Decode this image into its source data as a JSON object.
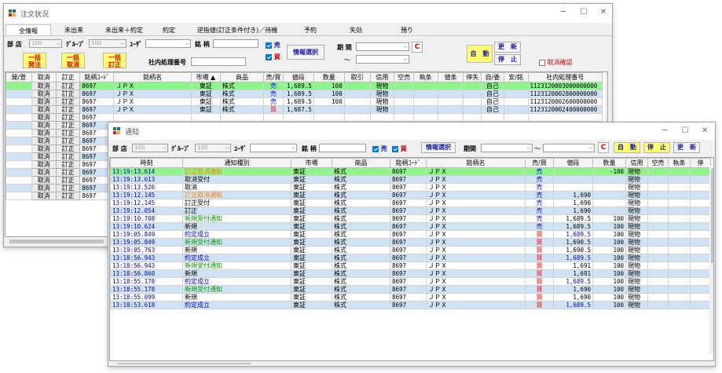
{
  "main": {
    "title": "注文状況",
    "tabs": [
      "全情報",
      "未出来",
      "未出来＋約定",
      "約定",
      "逆指値(訂正条件付き)／待機",
      "予約",
      "失効",
      "預り"
    ],
    "filters": {
      "busho_label": "部 店",
      "busho_value": "100",
      "group_label": "ｸﾞﾙｰﾌﾟ",
      "group_value": "100",
      "user_label": "ﾕｰｻﾞ",
      "user_value": "",
      "meigara_label": "銘 柄",
      "sell_label": "売",
      "buy_label": "買",
      "info_button": "情報選択",
      "period_label": "期 間",
      "tilde": "～",
      "clear_button": "C",
      "auto_button": "自　動",
      "update_button": "更　新",
      "stop_button": "停　止",
      "cancel_confirm_label": "取消確認",
      "internal_no_label": "社内処理番号"
    },
    "bulk_buttons": [
      {
        "l1": "一括",
        "l2": "発注"
      },
      {
        "l1": "一括",
        "l2": "取消"
      },
      {
        "l1": "一括",
        "l2": "訂正"
      }
    ],
    "columns": [
      "発/登",
      "取消",
      "訂正",
      "銘柄ｺｰﾄﾞ",
      "銘柄名",
      "市場 ▲",
      "商品",
      "売/買",
      "値段",
      "数量",
      "取引",
      "信用",
      "空売",
      "執条",
      "値条",
      "停失",
      "自/委",
      "安/銘",
      "社内処理番号"
    ],
    "rows": [
      {
        "cancel": "取消",
        "amend": "訂正",
        "code": "8697",
        "name": "ＪＰＸ",
        "market": "東証",
        "product": "株式",
        "side": "売",
        "price": "1,689.5",
        "qty": "100",
        "credit": "現物",
        "own": "自己",
        "no": "1123120003000000000",
        "style": "g"
      },
      {
        "cancel": "取消",
        "amend": "訂正",
        "code": "8697",
        "name": "ＪＰＸ",
        "market": "東証",
        "product": "株式",
        "side": "売",
        "price": "1,689.5",
        "qty": "100",
        "credit": "現物",
        "own": "自己",
        "no": "1123120002800000000",
        "style": "b"
      },
      {
        "cancel": "取消",
        "amend": "訂正",
        "code": "8697",
        "name": "ＪＰＸ",
        "market": "東証",
        "product": "株式",
        "side": "売",
        "price": "1,689.5",
        "qty": "100",
        "credit": "現物",
        "own": "自己",
        "no": "1123120002600000000",
        "style": "w"
      },
      {
        "cancel": "取消",
        "amend": "訂正",
        "code": "8697",
        "name": "ＪＰＸ",
        "market": "東証",
        "product": "株式",
        "side": "買",
        "price": "1,687.5",
        "qty": "",
        "credit": "現物",
        "own": "自己",
        "no": "1123120002400000000",
        "style": "b"
      },
      {
        "cancel": "取消",
        "amend": "訂正",
        "code": "8697",
        "style": "w"
      },
      {
        "cancel": "取消",
        "amend": "訂正",
        "code": "8697",
        "style": "b"
      },
      {
        "cancel": "取消",
        "amend": "訂正",
        "code": "8697",
        "style": "w"
      },
      {
        "cancel": "取消",
        "amend": "訂正",
        "code": "8697",
        "style": "b"
      },
      {
        "cancel": "取消",
        "amend": "訂正",
        "code": "8697",
        "style": "w"
      },
      {
        "cancel": "取消",
        "amend": "訂正",
        "code": "8697",
        "style": "b"
      },
      {
        "cancel": "取消",
        "amend": "訂正",
        "code": "8697",
        "style": "w"
      },
      {
        "cancel": "取消",
        "amend": "訂正",
        "code": "8697",
        "style": "b"
      },
      {
        "cancel": "取消",
        "amend": "訂正",
        "code": "8697",
        "style": "w"
      },
      {
        "cancel": "取消",
        "amend": "訂正",
        "code": "8697",
        "style": "b"
      },
      {
        "cancel": "取消",
        "amend": "訂正",
        "code": "8697",
        "style": "w"
      }
    ]
  },
  "notify": {
    "title": "通知",
    "filters": {
      "busho_label": "部 店",
      "busho_value": "100",
      "group_label": "ｸﾞﾙｰﾌﾟ",
      "group_value": "100",
      "user_label": "ﾕｰｻﾞ",
      "user_value": "",
      "meigara_label": "銘 柄",
      "sell_label": "売",
      "buy_label": "買",
      "info_button": "情報選択",
      "period_label": "期間",
      "tilde": "～",
      "clear_button": "C",
      "auto_button": "自　動",
      "stop_button": "停　止",
      "update_button": "更　新"
    },
    "columns": [
      "時刻",
      "通知種別",
      "市場",
      "商品",
      "銘柄ｺｰﾄﾞ",
      "銘柄名",
      "売/買",
      "値段",
      "数量",
      "信用",
      "空売",
      "執条",
      "停"
    ],
    "rows": [
      {
        "time": "13:19:13.614",
        "type": "訂正取消通知",
        "tc": "or",
        "side": "売",
        "price": "",
        "qty": "-100",
        "style": "g"
      },
      {
        "time": "13:19:13.613",
        "type": "取消受付",
        "tc": "",
        "side": "売",
        "price": "",
        "qty": "",
        "style": "b"
      },
      {
        "time": "13:19:13.526",
        "type": "取消",
        "tc": "",
        "side": "売",
        "price": "",
        "qty": "",
        "style": "w"
      },
      {
        "time": "13:19:12.145",
        "type": "訂正取消通知",
        "tc": "or",
        "side": "売",
        "price": "1,690",
        "qty": "",
        "style": "b"
      },
      {
        "time": "13:19:12.145",
        "type": "訂正受付",
        "tc": "",
        "side": "売",
        "price": "1,690",
        "qty": "",
        "style": "w"
      },
      {
        "time": "13:19:12.054",
        "type": "訂正",
        "tc": "",
        "side": "売",
        "price": "1,690",
        "qty": "",
        "style": "b"
      },
      {
        "time": "13:19:10.708",
        "type": "新規受付通知",
        "tc": "gr",
        "side": "売",
        "price": "1,689.5",
        "qty": "100",
        "style": "w"
      },
      {
        "time": "13:19:10.624",
        "type": "新規",
        "tc": "",
        "side": "売",
        "price": "1,689.5",
        "qty": "100",
        "style": "b"
      },
      {
        "time": "13:19:05.849",
        "type": "約定成立",
        "tc": "bl",
        "side": "買",
        "price": "1,689.5",
        "qty": "100",
        "style": "w"
      },
      {
        "time": "13:19:05.849",
        "type": "新規受付通知",
        "tc": "gr",
        "side": "買",
        "price": "1,690.5",
        "qty": "100",
        "style": "b"
      },
      {
        "time": "13:19:05.763",
        "type": "新規",
        "tc": "",
        "side": "買",
        "price": "1,690.5",
        "qty": "100",
        "style": "w"
      },
      {
        "time": "13:18:56.943",
        "type": "約定成立",
        "tc": "bl",
        "side": "買",
        "price": "1,689.5",
        "qty": "100",
        "style": "b"
      },
      {
        "time": "13:18:56.943",
        "type": "新規受付通知",
        "tc": "gr",
        "side": "買",
        "price": "1,691",
        "qty": "100",
        "style": "w"
      },
      {
        "time": "13:18:56.860",
        "type": "新規",
        "tc": "",
        "side": "買",
        "price": "1,691",
        "qty": "100",
        "style": "b"
      },
      {
        "time": "13:18:55.178",
        "type": "約定成立",
        "tc": "bl",
        "side": "買",
        "price": "1,689.5",
        "qty": "100",
        "style": "w"
      },
      {
        "time": "13:18:55.178",
        "type": "新規受付通知",
        "tc": "gr",
        "side": "買",
        "price": "1,690",
        "qty": "100",
        "style": "b"
      },
      {
        "time": "13:18:55.099",
        "type": "新規",
        "tc": "",
        "side": "買",
        "price": "1,690",
        "qty": "100",
        "style": "w"
      },
      {
        "time": "13:18:53.618",
        "type": "約定成立",
        "tc": "bl",
        "side": "買",
        "price": "1,689.5",
        "qty": "100",
        "style": "b"
      }
    ],
    "common": {
      "market": "東証",
      "product": "株式",
      "code": "8697",
      "name": "ＪＰＸ",
      "credit": "現物"
    }
  },
  "colors": {
    "green_row": "#8ef58a",
    "blue_row": "#cfe3f5",
    "sell": "#0000ff",
    "buy": "#ff0000",
    "button_yellow": "#ffff6e"
  }
}
